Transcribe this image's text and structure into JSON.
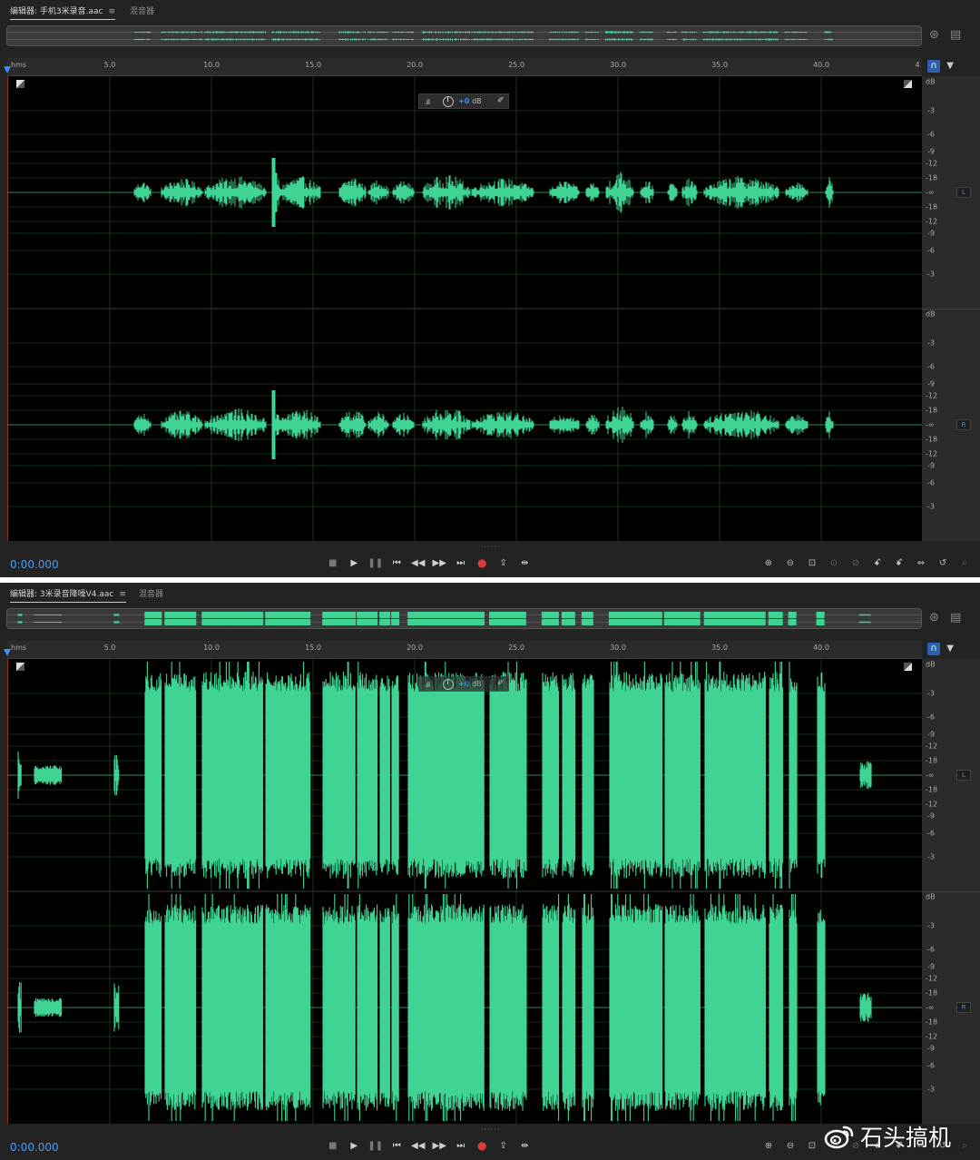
{
  "editors": [
    {
      "editor_tab_label": "编辑器: 手机3米录音.aac",
      "mixer_tab_label": "混音器",
      "menu_icon": "≡",
      "ruler_unit": "hms",
      "time_ticks": [
        "5.0",
        "10.0",
        "15.0",
        "20.0",
        "25.0",
        "30.0",
        "35.0",
        "40.0",
        "4"
      ],
      "db_ticks": [
        "dB",
        "-3",
        "-6",
        "-9",
        "-12",
        "-18",
        "-∞",
        "-18",
        "-12",
        "-9",
        "-6",
        "-3"
      ],
      "channels": [
        "L",
        "R"
      ],
      "hud_value": "+0",
      "hud_unit": "dB",
      "time_display": "0:00.000",
      "waveform_level": "quiet"
    },
    {
      "editor_tab_label": "编辑器: 3米录音降噪V4.aac",
      "mixer_tab_label": "混音器",
      "menu_icon": "≡",
      "ruler_unit": "hms",
      "time_ticks": [
        "5.0",
        "10.0",
        "15.0",
        "20.0",
        "25.0",
        "30.0",
        "35.0",
        "40.0"
      ],
      "db_ticks": [
        "dB",
        "-3",
        "-6",
        "-9",
        "-12",
        "-18",
        "-∞",
        "-18",
        "-12",
        "-9",
        "-6",
        "-3"
      ],
      "channels": [
        "L",
        "R"
      ],
      "hud_value": "+0",
      "hud_unit": "dB",
      "time_display": "0:00.000",
      "waveform_level": "loud"
    }
  ],
  "transport_buttons": [
    {
      "name": "stop-button",
      "glyph": "■"
    },
    {
      "name": "play-button",
      "glyph": "▶"
    },
    {
      "name": "pause-button",
      "glyph": "❚❚"
    },
    {
      "name": "go-to-start-button",
      "glyph": "⏮"
    },
    {
      "name": "rewind-button",
      "glyph": "◀◀"
    },
    {
      "name": "fast-forward-button",
      "glyph": "▶▶"
    },
    {
      "name": "go-to-end-button",
      "glyph": "⏭"
    },
    {
      "name": "record-button",
      "glyph": "●"
    },
    {
      "name": "loop-playback-button",
      "glyph": "⇪"
    },
    {
      "name": "skip-selection-button",
      "glyph": "⇹"
    }
  ],
  "zoom_buttons": [
    {
      "name": "zoom-in-amplitude-button",
      "glyph": "⊕"
    },
    {
      "name": "zoom-out-amplitude-button",
      "glyph": "⊖"
    },
    {
      "name": "zoom-full-button",
      "glyph": "⊡"
    },
    {
      "name": "zoom-in-selection-button",
      "glyph": "⊙"
    },
    {
      "name": "zoom-out-selection-button",
      "glyph": "⊘"
    },
    {
      "name": "zoom-in-time-button",
      "glyph": "ꗃ"
    },
    {
      "name": "zoom-out-time-button",
      "glyph": "ꗄ"
    },
    {
      "name": "zoom-out-full-button",
      "glyph": "⇔"
    },
    {
      "name": "zoom-reset-button",
      "glyph": "↺"
    },
    {
      "name": "zoom-inspect-button",
      "glyph": "⌕"
    }
  ],
  "icons": {
    "monitor_icon": "headphones-icon",
    "marker_icon": "pin-icon",
    "overview_settings_icon": "speaker-icon",
    "overview_list_icon": "list-icon"
  },
  "colors": {
    "waveform": "#3fd494",
    "playhead": "#3b8cff",
    "time_display": "#4a9bff",
    "record": "#e03b3b"
  },
  "watermark": {
    "text": "石头搞机"
  }
}
